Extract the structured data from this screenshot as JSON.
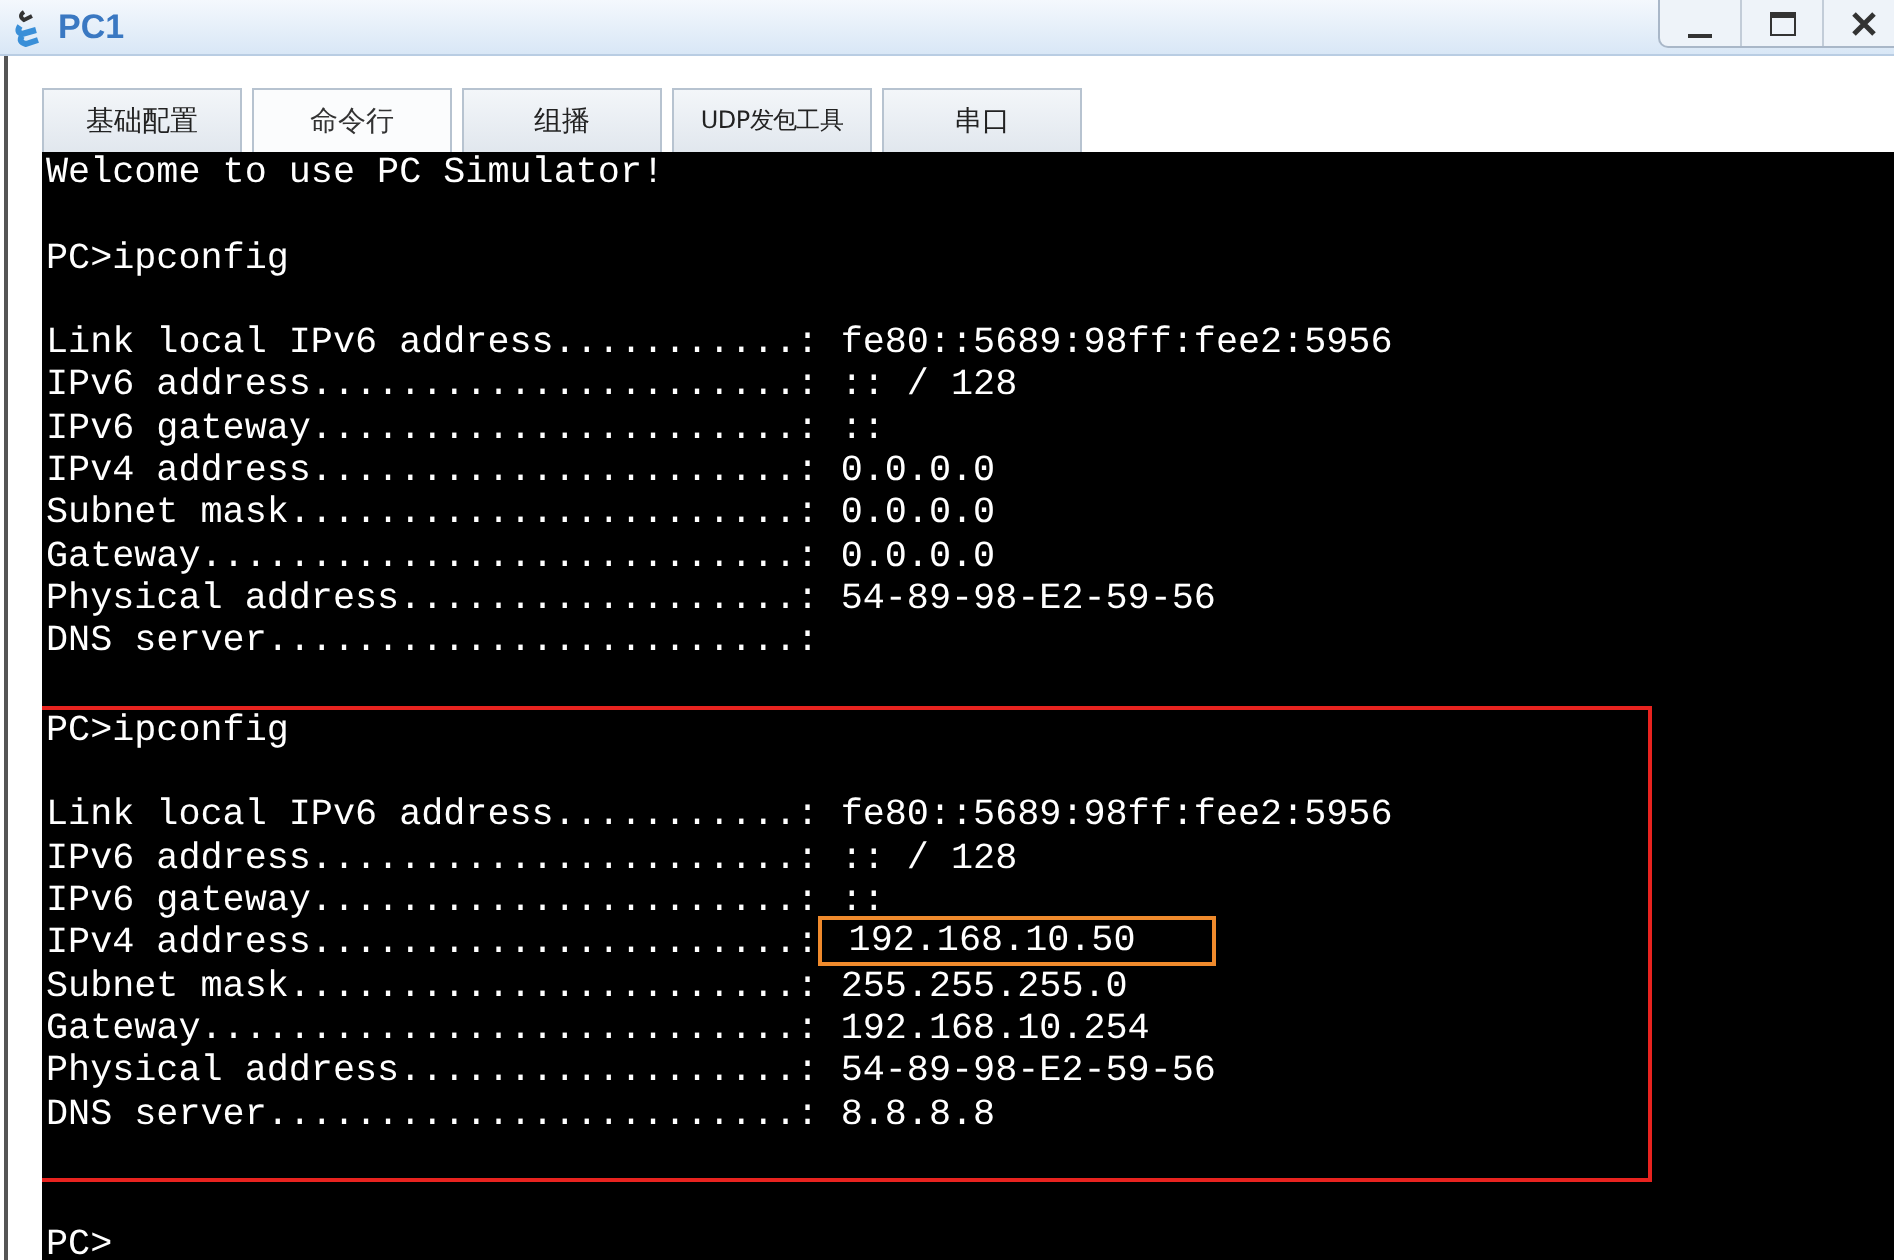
{
  "window": {
    "title": "PC1"
  },
  "tabs": [
    {
      "label": "基础配置",
      "selected": false
    },
    {
      "label": "命令行",
      "selected": true
    },
    {
      "label": "组播",
      "selected": false
    },
    {
      "label": "UDP发包工具",
      "selected": false
    },
    {
      "label": "串口",
      "selected": false
    }
  ],
  "terminal": {
    "welcome": "Welcome to use PC Simulator!",
    "sessions": [
      {
        "highlighted": false,
        "command": "PC>ipconfig",
        "fields": [
          {
            "label": "Link local IPv6 address...........:",
            "value": "fe80::5689:98ff:fee2:5956"
          },
          {
            "label": "IPv6 address......................:",
            "value": ":: / 128"
          },
          {
            "label": "IPv6 gateway......................:",
            "value": "::"
          },
          {
            "label": "IPv4 address......................:",
            "value": "0.0.0.0"
          },
          {
            "label": "Subnet mask.......................:",
            "value": "0.0.0.0"
          },
          {
            "label": "Gateway...........................:",
            "value": "0.0.0.0"
          },
          {
            "label": "Physical address..................:",
            "value": "54-89-98-E2-59-56"
          },
          {
            "label": "DNS server........................:"
          }
        ]
      },
      {
        "highlighted": true,
        "command": "PC>ipconfig",
        "fields": [
          {
            "label": "Link local IPv6 address...........:",
            "value": "fe80::5689:98ff:fee2:5956",
            "highlighted": false
          },
          {
            "label": "IPv6 address......................:",
            "value": ":: / 128",
            "highlighted": false
          },
          {
            "label": "IPv6 gateway......................:",
            "value": "::",
            "highlighted": false
          },
          {
            "label": "IPv4 address......................:",
            "value": "192.168.10.50",
            "highlighted": true
          },
          {
            "label": "Subnet mask.......................:",
            "value": "255.255.255.0",
            "highlighted": false
          },
          {
            "label": "Gateway...........................:",
            "value": "192.168.10.254",
            "highlighted": false
          },
          {
            "label": "Physical address..................:",
            "value": "54-89-98-E2-59-56",
            "highlighted": false
          },
          {
            "label": "DNS server........................:",
            "value": "8.8.8.8",
            "highlighted": false
          }
        ]
      }
    ],
    "prompt": "PC>"
  }
}
